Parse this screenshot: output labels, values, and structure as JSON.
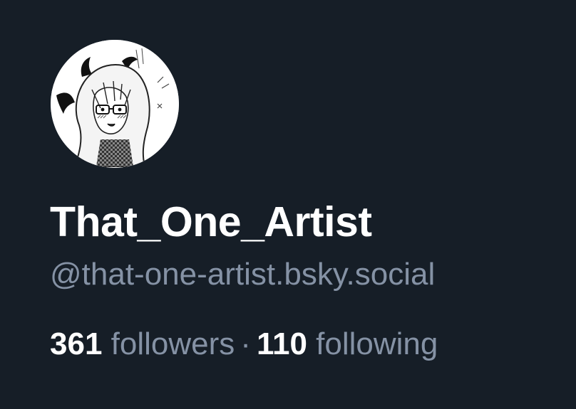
{
  "profile": {
    "display_name": "That_One_Artist",
    "handle": "@that-one-artist.bsky.social",
    "followers_count": "361",
    "followers_label": "followers",
    "separator": "·",
    "following_count": "110",
    "following_label": "following",
    "avatar_icon": "anime-girl-sketch-avatar"
  },
  "colors": {
    "background": "#161e27",
    "primary_text": "#ffffff",
    "secondary_text": "#8592a5"
  }
}
